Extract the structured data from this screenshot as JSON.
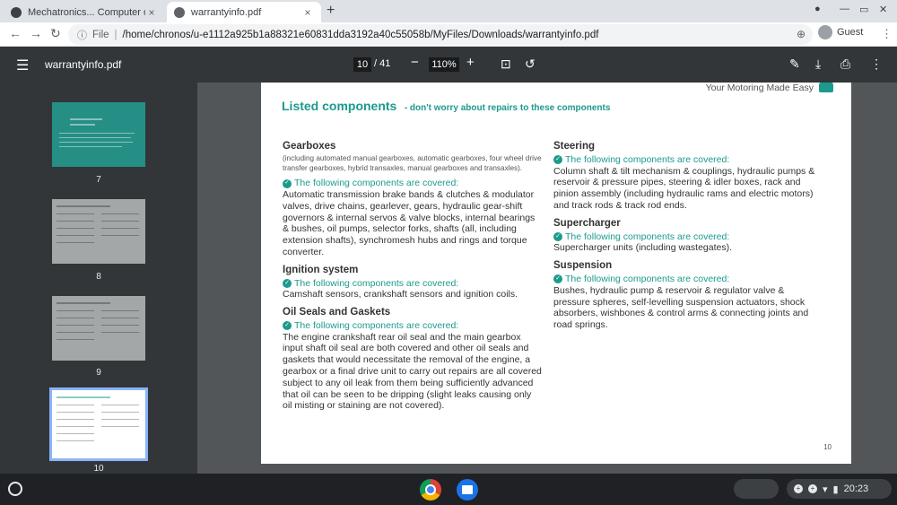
{
  "browser": {
    "tabs": [
      {
        "title": "Mechatronics... Computer or not",
        "close": "×"
      },
      {
        "title": "warrantyinfo.pdf",
        "close": "×"
      }
    ],
    "new_tab": "+",
    "url_scheme": "File",
    "url_sep": "|",
    "url": "/home/chronos/u-e1112a925b1a88321e60831dda3192a40c55058b/MyFiles/Downloads/warrantyinfo.pdf",
    "profile": "Guest"
  },
  "pdf_toolbar": {
    "filename": "warrantyinfo.pdf",
    "current_page": "10",
    "total_pages": "/ 41",
    "zoom": "110%"
  },
  "thumbnails": [
    {
      "label": "7"
    },
    {
      "label": "8"
    },
    {
      "label": "9"
    },
    {
      "label": "10"
    }
  ],
  "page": {
    "tagline": "Your Motoring Made Easy",
    "title": "Listed components",
    "subtitle": "- don't worry about repairs to these components",
    "covered_label": "The following components are covered:",
    "page_number": "10",
    "left_sections": [
      {
        "heading": "Gearboxes",
        "note": "(including automated manual gearboxes, automatic gearboxes, four wheel drive transfer gearboxes, hybrid transaxles, manual gearboxes and transaxles).",
        "text": "Automatic transmission brake bands & clutches & modulator valves, drive chains, gearlever, gears, hydraulic gear-shift governors & internal servos & valve blocks, internal bearings & bushes, oil pumps, selector forks, shafts (all, including extension shafts), synchromesh hubs and rings and torque converter."
      },
      {
        "heading": "Ignition system",
        "text": "Camshaft sensors, crankshaft sensors and ignition coils."
      },
      {
        "heading": "Oil Seals and Gaskets",
        "text": "The engine crankshaft rear oil seal and the main gearbox input shaft oil seal are both covered and other oil seals and gaskets that would necessitate the removal of the engine, a gearbox or a final drive unit to carry out repairs are all covered subject to any oil leak from them being sufficiently advanced that oil can be seen to be dripping (slight leaks causing only oil misting or staining are not covered)."
      }
    ],
    "right_sections": [
      {
        "heading": "Steering",
        "text": "Column shaft & tilt mechanism & couplings, hydraulic pumps & reservoir & pressure pipes, steering & idler boxes, rack and pinion assembly (including hydraulic rams and electric motors) and track rods & track rod ends."
      },
      {
        "heading": "Supercharger",
        "text": "Supercharger units (including wastegates)."
      },
      {
        "heading": "Suspension",
        "text": "Bushes, hydraulic pump & reservoir & regulator valve & pressure spheres, self-levelling suspension actuators, shock absorbers, wishbones & control arms & connecting joints and road springs."
      }
    ]
  },
  "shelf": {
    "time": "20:23"
  },
  "icons": {
    "back": "arrow-left-icon",
    "forward": "arrow-right-icon",
    "reload": "reload-icon",
    "menu": "hamburger-icon",
    "pen": "pen-icon",
    "download": "download-icon",
    "print": "print-icon"
  },
  "colors": {
    "accent": "#1c9a8e",
    "pdf_toolbar": "#323639",
    "viewer_bg": "#525659",
    "shelf": "#202124"
  }
}
